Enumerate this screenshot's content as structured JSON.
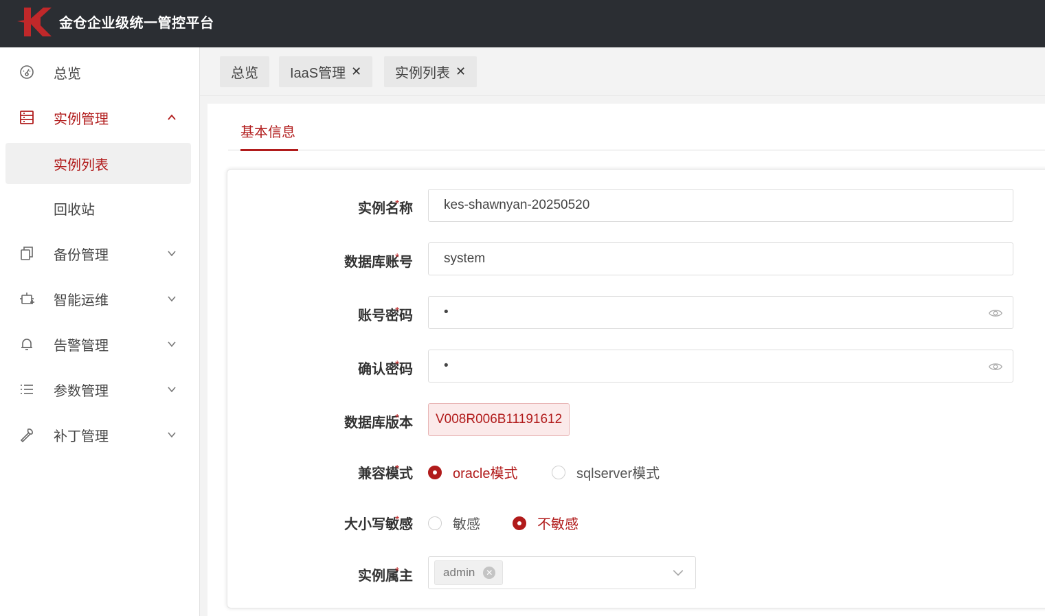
{
  "app": {
    "title": "金仓企业级统一管控平台"
  },
  "sidebar": {
    "items": [
      {
        "label": "总览",
        "icon": "dashboard-icon"
      },
      {
        "label": "实例管理",
        "icon": "server-list-icon",
        "expanded": true
      },
      {
        "label": "实例列表",
        "sub": true,
        "selected": true
      },
      {
        "label": "回收站",
        "sub": true
      },
      {
        "label": "备份管理",
        "icon": "copy-icon"
      },
      {
        "label": "智能运维",
        "icon": "robot-icon"
      },
      {
        "label": "告警管理",
        "icon": "bell-icon"
      },
      {
        "label": "参数管理",
        "icon": "list-icon"
      },
      {
        "label": "补丁管理",
        "icon": "wrench-icon"
      }
    ]
  },
  "tabs": [
    {
      "label": "总览",
      "closable": false
    },
    {
      "label": "IaaS管理",
      "closable": true
    },
    {
      "label": "实例列表",
      "closable": true
    }
  ],
  "subtab": {
    "label": "基本信息"
  },
  "form": {
    "instance_name": {
      "label": "实例名称",
      "value": "kes-shawnyan-20250520"
    },
    "db_account": {
      "label": "数据库账号",
      "value": "system"
    },
    "password": {
      "label": "账号密码",
      "value": "•"
    },
    "confirm_password": {
      "label": "确认密码",
      "value": "•"
    },
    "db_version": {
      "label": "数据库版本",
      "value": "V008R006B11191612"
    },
    "compat_mode": {
      "label": "兼容模式",
      "options": [
        "oracle模式",
        "sqlserver模式"
      ],
      "selected": "oracle模式"
    },
    "case_sensitive": {
      "label": "大小写敏感",
      "options": [
        "敏感",
        "不敏感"
      ],
      "selected": "不敏感"
    },
    "owner": {
      "label": "实例属主",
      "value": "admin"
    },
    "required_mark": "*"
  },
  "colors": {
    "accent": "#b11b1b",
    "topbar": "#2b2e33"
  }
}
